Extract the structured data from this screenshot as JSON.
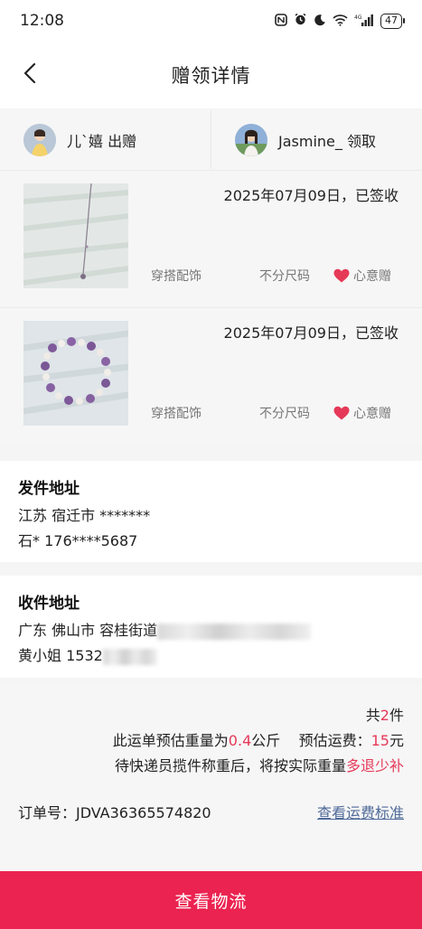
{
  "status_bar": {
    "time": "12:08",
    "network": "4G",
    "battery": "47"
  },
  "header": {
    "title": "赠领详情"
  },
  "people": [
    {
      "name": "儿`嬉 出赠"
    },
    {
      "name": "Jasmine_ 领取"
    }
  ],
  "items": [
    {
      "date": "2025年07月09日，已签收",
      "category": "穿搭配饰",
      "size": "不分尺码",
      "badge": "心意赠"
    },
    {
      "date": "2025年07月09日，已签收",
      "category": "穿搭配饰",
      "size": "不分尺码",
      "badge": "心意赠"
    }
  ],
  "sender": {
    "heading": "发件地址",
    "region": "江苏 宿迁市 *******",
    "contact": "石* 176****5687"
  },
  "receiver": {
    "heading": "收件地址",
    "region": "广东 佛山市 容桂街道",
    "contact": "黄小姐 1532"
  },
  "summary": {
    "count_prefix": "共",
    "count": "2",
    "count_suffix": "件",
    "weight_prefix": "此运单预估重量为",
    "weight": "0.4",
    "weight_unit": "公斤",
    "fee_prefix": "预估运费：",
    "fee": "15",
    "fee_unit": "元",
    "note_prefix": "待快递员揽件称重后，将按实际重量",
    "note_highlight": "多退少补",
    "order_label": "订单号：JDVA36365574820",
    "fee_standard_link": "查看运费标准"
  },
  "footer": {
    "button_label": "查看物流"
  },
  "colors": {
    "accent": "#eb2350",
    "highlight": "#e63958",
    "link": "#4f6a99"
  }
}
